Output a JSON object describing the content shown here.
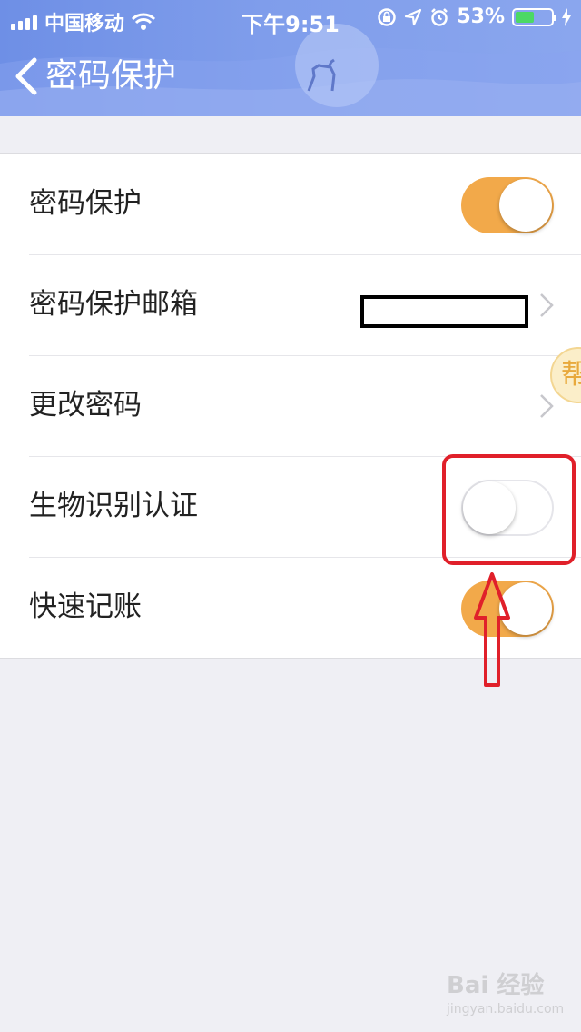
{
  "status_bar": {
    "carrier": "中国移动",
    "time": "下午9:51",
    "battery_percent": "53%",
    "battery_level": 0.53
  },
  "nav": {
    "title": "密码保护"
  },
  "settings": {
    "rows": [
      {
        "label": "密码保护",
        "control": "toggle",
        "on": true
      },
      {
        "label": "密码保护邮箱",
        "control": "chevron"
      },
      {
        "label": "更改密码",
        "control": "chevron"
      },
      {
        "label": "生物识别认证",
        "control": "toggle",
        "on": false
      },
      {
        "label": "快速记账",
        "control": "toggle",
        "on": true
      }
    ]
  },
  "side_badge": {
    "text": "帮"
  },
  "watermark": {
    "main": "Bai 经验",
    "sub": "jingyan.baidu.com"
  },
  "colors": {
    "header": "#7f9deb",
    "toggle_on": "#f2a94a",
    "annotation": "#e0202a",
    "background": "#efeff4"
  }
}
